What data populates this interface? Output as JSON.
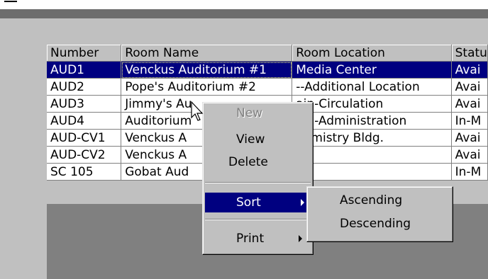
{
  "grid": {
    "columns": [
      "Number",
      "Room Name",
      "Room Location",
      "Statu"
    ],
    "rows": [
      [
        "AUD1",
        "Venckus Auditorium #1",
        "Media Center",
        "Avai"
      ],
      [
        "AUD2",
        "Pope's Auditorium #2",
        "--Additional Location",
        "Avai"
      ],
      [
        "AUD3",
        "Jimmy's Au",
        "ain-Circulation",
        "Avai"
      ],
      [
        "AUD4",
        "Auditorium",
        "ain-Administration",
        "In-M"
      ],
      [
        "AUD-CV1",
        "Venckus A",
        "hemistry Bldg.",
        "Avai"
      ],
      [
        "AUD-CV2",
        "Venckus A",
        "",
        "Avai"
      ],
      [
        "SC 105",
        "Gobat Aud",
        "",
        "In-M"
      ]
    ]
  },
  "context_menu": {
    "new": "New",
    "view": "View",
    "delete": "Delete",
    "sort": "Sort",
    "print": "Print"
  },
  "sort_submenu": {
    "ascending": "Ascending",
    "descending": "Descending"
  },
  "colors": {
    "selection": "#000080",
    "face": "#c0c0c0",
    "shadow": "#808080"
  }
}
